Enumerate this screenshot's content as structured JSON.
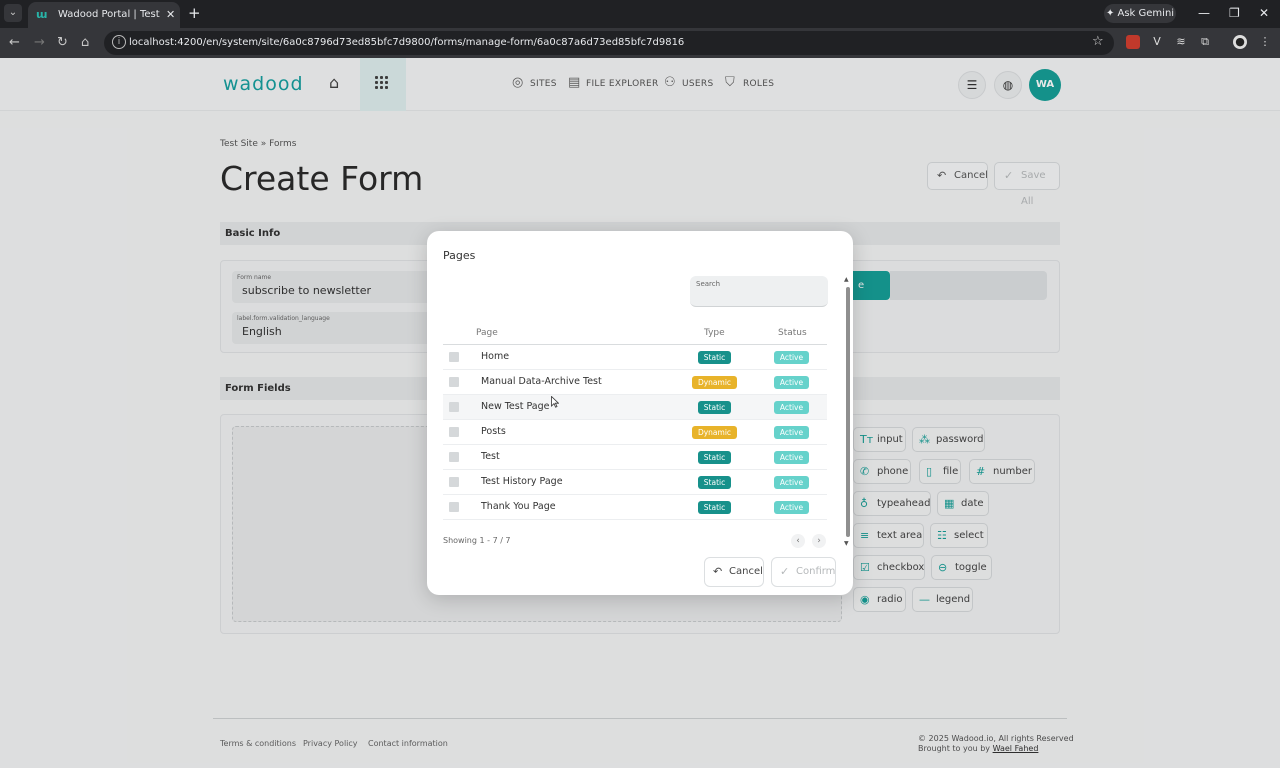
{
  "browser": {
    "tab_title": "Wadood Portal | Test Site - Create",
    "url": "localhost:4200/en/system/site/6a0c8796d73ed85bfc7d9800/forms/manage-form/6a0c87a6d73ed85bfc7d9816",
    "gemini_label": "Ask Gemini"
  },
  "header": {
    "logo": "wadood",
    "nav": [
      {
        "label": "SITES",
        "icon": "globe-icon"
      },
      {
        "label": "FILE EXPLORER",
        "icon": "folder-icon"
      },
      {
        "label": "USERS",
        "icon": "users-icon"
      },
      {
        "label": "ROLES",
        "icon": "shield-icon"
      }
    ],
    "avatar_initials": "WA"
  },
  "page": {
    "breadcrumb": "Test Site  » Forms",
    "title": "Create Form",
    "cancel_label": "Cancel",
    "save_all_label": "Save All",
    "basic_info_heading": "Basic Info",
    "form_name_label": "Form name",
    "form_name_value": "subscribe to newsletter",
    "validation_language_label": "label.form.validation_language",
    "validation_language_value": "English",
    "hidden_button_fragment": "e",
    "form_fields_heading": "Form Fields"
  },
  "field_types": [
    {
      "label": "input",
      "icon": "text-type-icon"
    },
    {
      "label": "password",
      "icon": "password-icon"
    },
    {
      "label": "phone",
      "icon": "phone-icon"
    },
    {
      "label": "file",
      "icon": "file-icon"
    },
    {
      "label": "number",
      "icon": "hash-icon"
    },
    {
      "label": "typeahead",
      "icon": "lightbulb-icon"
    },
    {
      "label": "date",
      "icon": "calendar-icon"
    },
    {
      "label": "text area",
      "icon": "textarea-icon"
    },
    {
      "label": "select",
      "icon": "select-list-icon"
    },
    {
      "label": "checkbox",
      "icon": "checkbox-icon"
    },
    {
      "label": "toggle",
      "icon": "toggle-icon"
    },
    {
      "label": "radio",
      "icon": "radio-icon"
    },
    {
      "label": "legend",
      "icon": "minus-icon"
    }
  ],
  "modal": {
    "title": "Pages",
    "search_label": "Search",
    "search_value": "",
    "columns": {
      "page": "Page",
      "type": "Type",
      "status": "Status"
    },
    "rows": [
      {
        "page": "Home",
        "type": "Static",
        "status": "Active"
      },
      {
        "page": "Manual Data-Archive Test",
        "type": "Dynamic",
        "status": "Active"
      },
      {
        "page": "New Test Page",
        "type": "Static",
        "status": "Active"
      },
      {
        "page": "Posts",
        "type": "Dynamic",
        "status": "Active"
      },
      {
        "page": "Test",
        "type": "Static",
        "status": "Active"
      },
      {
        "page": "Test History Page",
        "type": "Static",
        "status": "Active"
      },
      {
        "page": "Thank You Page",
        "type": "Static",
        "status": "Active"
      }
    ],
    "showing": "Showing 1 - 7 / 7",
    "cancel_label": "Cancel",
    "confirm_label": "Confirm"
  },
  "footer": {
    "links": [
      "Terms & conditions",
      "Privacy Policy",
      "Contact information"
    ],
    "copyright": "© 2025 Wadood.io, All rights Reserved",
    "brought_by": "Brought to you by ",
    "author": "Wael Fahed"
  },
  "colors": {
    "brand": "#17a098",
    "static_badge": "#17918b",
    "dynamic_badge": "#e8b32a",
    "active_badge": "#66d2cb"
  }
}
